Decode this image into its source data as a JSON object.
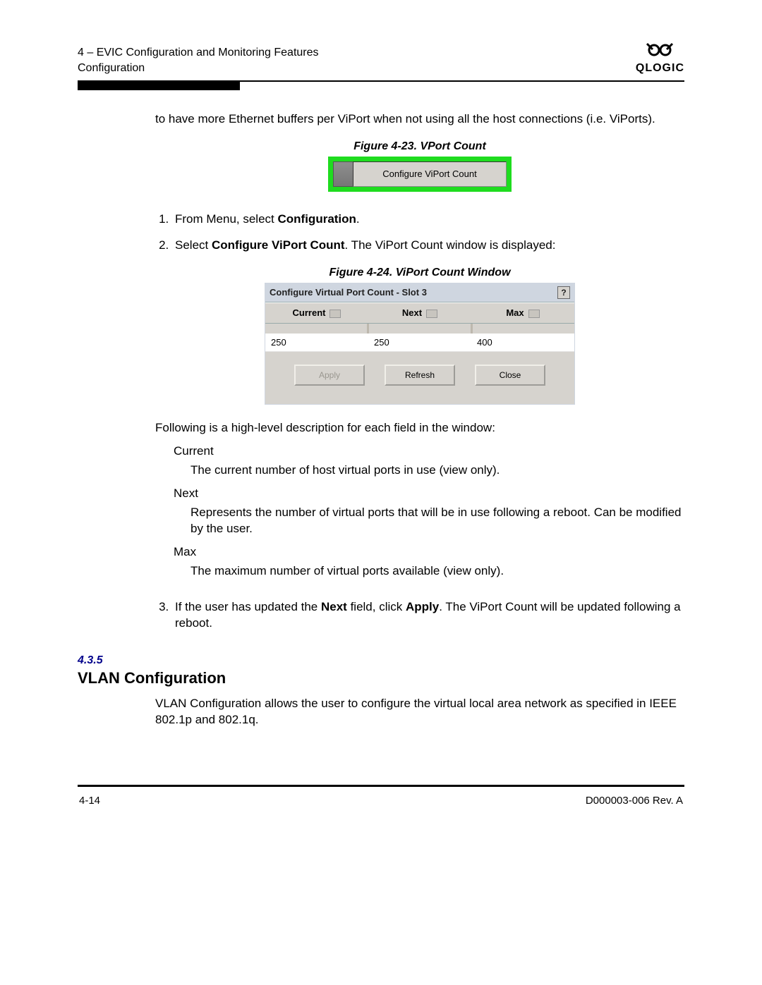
{
  "header": {
    "line1": "4 – EVIC Configuration and Monitoring Features",
    "line2": "Configuration",
    "logo_text": "QLOGIC"
  },
  "intro": {
    "text_pre": "to have more Ethernet buffers per ViPort when not using all the host connections (i.e. ViPorts)."
  },
  "fig23": {
    "caption": "Figure 4-23. VPort Count",
    "menu_item": "Configure ViPort Count"
  },
  "steps": {
    "s1_pre": "From Menu, select ",
    "s1_bold": "Configuration",
    "s1_post": ".",
    "s2_pre": "Select ",
    "s2_bold": "Configure ViPort Count",
    "s2_post": ". The ViPort Count window is displayed:"
  },
  "fig24": {
    "caption": "Figure 4-24. ViPort Count Window",
    "title": "Configure Virtual Port Count - Slot 3",
    "help": "?",
    "col1": "Current",
    "col2": "Next",
    "col3": "Max",
    "val1": "250",
    "val2": "250",
    "val3": "400",
    "btn_apply": "Apply",
    "btn_refresh": "Refresh",
    "btn_close": "Close"
  },
  "followup": "Following is a high-level description for each field in the window:",
  "fields": {
    "current_term": "Current",
    "current_desc": "The current number of host virtual ports in use (view only).",
    "next_term": "Next",
    "next_desc": "Represents the number of virtual ports that will be in use following a reboot. Can be modified by the user.",
    "max_term": "Max",
    "max_desc": "The maximum number of virtual ports available (view only)."
  },
  "step3": {
    "pre": "If the user has updated the ",
    "b1": "Next",
    "mid": " field, click ",
    "b2": "Apply",
    "post": ". The ViPort Count will be updated following a reboot."
  },
  "section": {
    "num": "4.3.5",
    "title": "VLAN Configuration",
    "body": "VLAN Configuration allows the user to configure the virtual local area network as specified in IEEE 802.1p and 802.1q."
  },
  "footer": {
    "left": "4-14",
    "right": "D000003-006 Rev. A"
  }
}
